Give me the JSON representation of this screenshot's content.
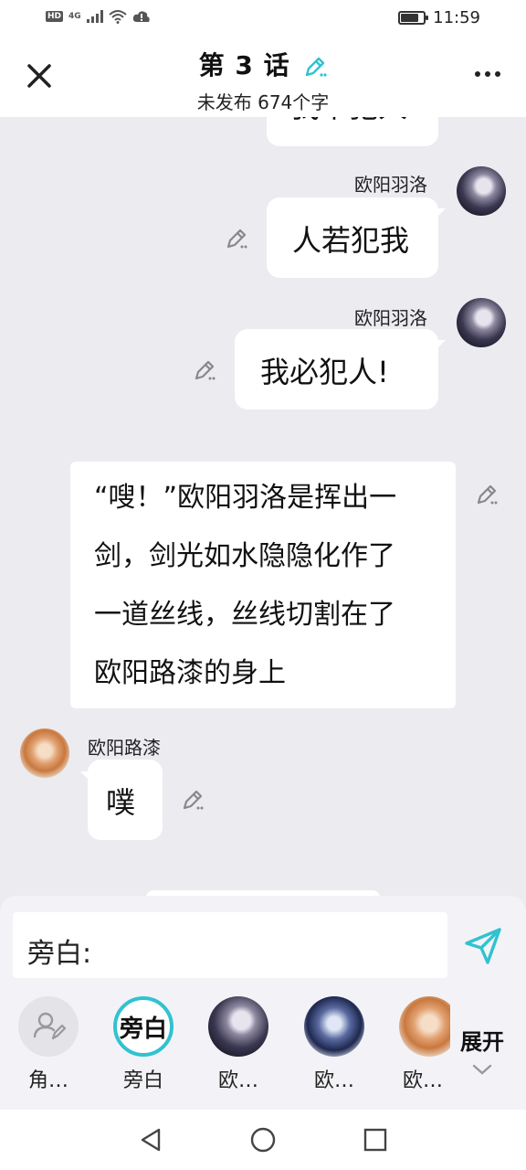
{
  "status_bar": {
    "hd": "HD",
    "network": "4G",
    "time": "11:59",
    "battery_level": 0.72
  },
  "header": {
    "title": "第 3 话",
    "subtitle": "未发布 674个字"
  },
  "messages": [
    {
      "id": "partial",
      "side": "right",
      "text": "我不犯人"
    },
    {
      "id": "m1",
      "side": "right",
      "speaker": "欧阳羽洛",
      "text": "人若犯我"
    },
    {
      "id": "m2",
      "side": "right",
      "speaker": "欧阳羽洛",
      "text": "我必犯人!"
    },
    {
      "id": "m3",
      "side": "narration",
      "lines": [
        "“嗖！”欧阳羽洛是挥出一",
        "剑，剑光如水隐隐化作了",
        "一道丝线，丝线切割在了",
        "欧阳路漆的身上"
      ]
    },
    {
      "id": "m4",
      "side": "left",
      "speaker": "欧阳路漆",
      "text": "噗"
    }
  ],
  "composer": {
    "label": "旁白:"
  },
  "roles": [
    {
      "label": "角…",
      "icon": "add-role-icon"
    },
    {
      "label": "旁白",
      "badge": "旁白",
      "selected": true
    },
    {
      "label": "欧…",
      "avatar": "dark"
    },
    {
      "label": "欧…",
      "avatar": "blue"
    },
    {
      "label": "欧…",
      "avatar": "warm"
    }
  ],
  "expand": {
    "label": "展开"
  },
  "colors": {
    "accent": "#31c2d0",
    "background": "#ebebf0",
    "bubble": "#ffffff"
  }
}
